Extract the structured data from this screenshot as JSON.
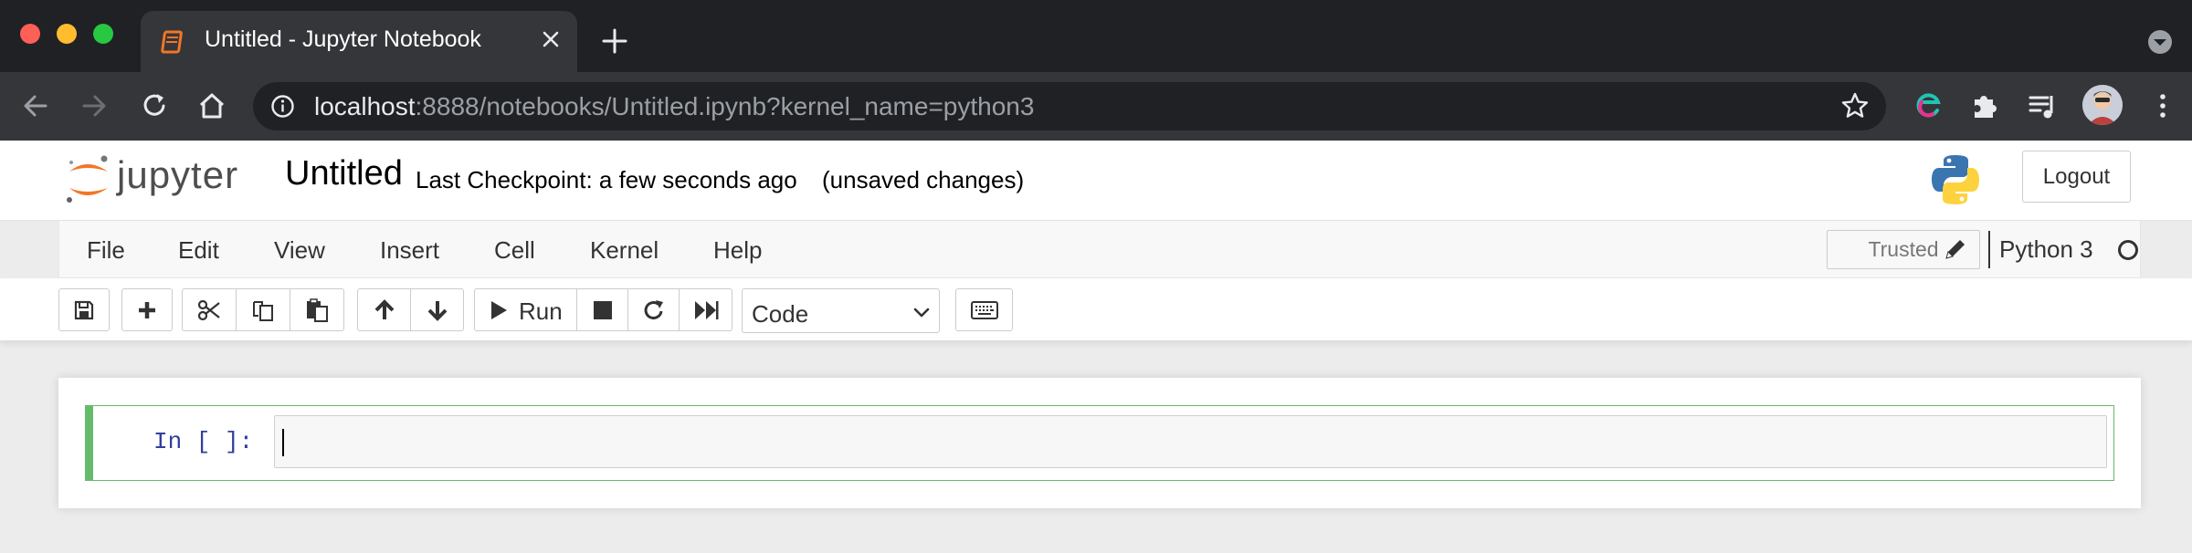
{
  "browser": {
    "tab_title": "Untitled - Jupyter Notebook",
    "url_host": "localhost",
    "url_rest": ":8888/notebooks/Untitled.ipynb?kernel_name=python3",
    "icons": [
      "back-arrow-icon",
      "forward-arrow-icon",
      "reload-icon",
      "home-icon",
      "info-icon",
      "star-icon",
      "edge-extension-icon",
      "puzzle-icon",
      "media-queue-icon",
      "kebab-menu-icon"
    ],
    "colors": {
      "tabstrip": "#202124",
      "toolbar": "#35363a",
      "tab_favicon": "#f37626"
    }
  },
  "header": {
    "logo_text": "jupyter",
    "notebook_name": "Untitled",
    "checkpoint": "Last Checkpoint: a few seconds ago",
    "autosave_status": "(unsaved changes)",
    "logout_label": "Logout"
  },
  "menubar": {
    "items": [
      "File",
      "Edit",
      "View",
      "Insert",
      "Cell",
      "Kernel",
      "Help"
    ],
    "trusted_label": "Trusted",
    "kernel_name": "Python 3"
  },
  "toolbar": {
    "run_label": "Run",
    "cell_type": "Code",
    "icons": [
      "save-icon",
      "plus-icon",
      "scissors-icon",
      "copy-icon",
      "paste-icon",
      "arrow-up-icon",
      "arrow-down-icon",
      "play-icon",
      "stop-icon",
      "restart-icon",
      "fast-forward-icon",
      "keyboard-icon"
    ]
  },
  "notebook": {
    "cells": [
      {
        "prompt": "In [ ]:",
        "source": ""
      }
    ],
    "accent": "#66bb6a",
    "prompt_color": "#303f9f"
  }
}
